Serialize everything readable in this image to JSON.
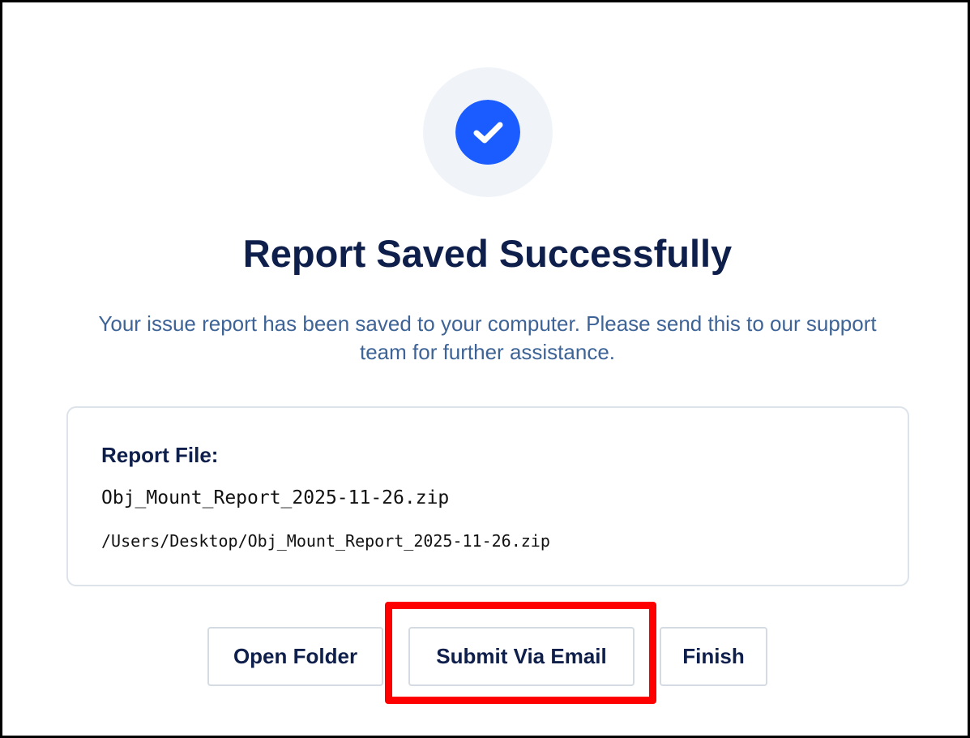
{
  "dialog": {
    "title": "Report Saved Successfully",
    "message": "Your issue report has been saved to your computer. Please send this to our support team for further assistance.",
    "status_icon": "check-circle-icon",
    "accent_color": "#1a5cff",
    "title_color": "#0f1f4b",
    "message_color": "#3e6497"
  },
  "report_file": {
    "label": "Report File:",
    "file_name": "Obj_Mount_Report_2025-11-26.zip",
    "file_path": "/Users/Desktop/Obj_Mount_Report_2025-11-26.zip"
  },
  "actions": {
    "open_folder_label": "Open Folder",
    "submit_email_label": "Submit Via Email",
    "finish_label": "Finish"
  },
  "annotation": {
    "highlight_color": "#ff0000",
    "highlighted_action": "Submit Via Email"
  }
}
